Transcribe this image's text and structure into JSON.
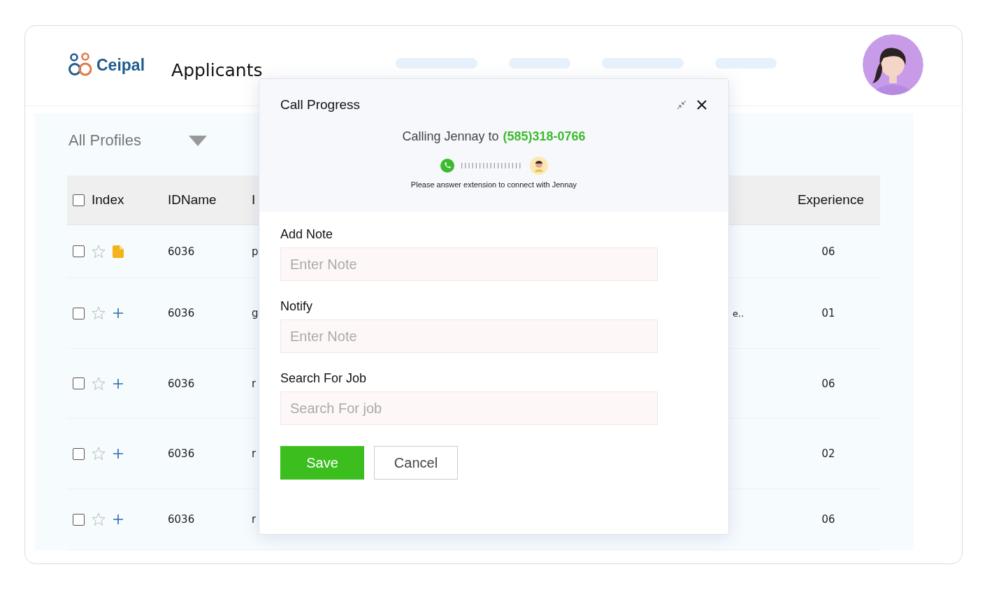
{
  "header": {
    "logo": "Ceipal",
    "title": "Applicants"
  },
  "filter": {
    "value": "All Profiles"
  },
  "table": {
    "select_all": {
      "checked": false
    },
    "columns": [
      {
        "label": "Index"
      },
      {
        "label": "IDName"
      },
      {
        "label": "I"
      },
      {
        "label": "Experience"
      }
    ],
    "rows": [
      {
        "checked": false,
        "starred": false,
        "kind": "file",
        "id": "6036",
        "column_3": "p",
        "experience": "06"
      },
      {
        "checked": false,
        "starred": false,
        "kind": "add",
        "id": "6036",
        "column_3": "g",
        "column_4": "e..",
        "experience": "01"
      },
      {
        "checked": false,
        "starred": false,
        "kind": "add",
        "id": "6036",
        "column_3": "r",
        "experience": "06"
      },
      {
        "checked": false,
        "starred": false,
        "kind": "add",
        "id": "6036",
        "column_3": "r",
        "experience": "02"
      },
      {
        "checked": false,
        "starred": false,
        "kind": "add",
        "id": "6036",
        "column_3": "r",
        "experience": "06"
      }
    ]
  },
  "dialog": {
    "title": "Call Progress",
    "calling_text": "Calling Jennay to",
    "phone": "(585)318-0766",
    "hint": "Please answer extension to connect with Jennay",
    "fields": [
      {
        "label": "Add Note",
        "placeholder": "Enter Note"
      },
      {
        "label": "Notify",
        "placeholder": "Enter Note"
      },
      {
        "label": "Search For Job",
        "placeholder": "Search For job"
      }
    ],
    "buttons": [
      {
        "label": "Save",
        "kind": "primary"
      },
      {
        "label": "Cancel",
        "kind": "secondary"
      }
    ]
  }
}
